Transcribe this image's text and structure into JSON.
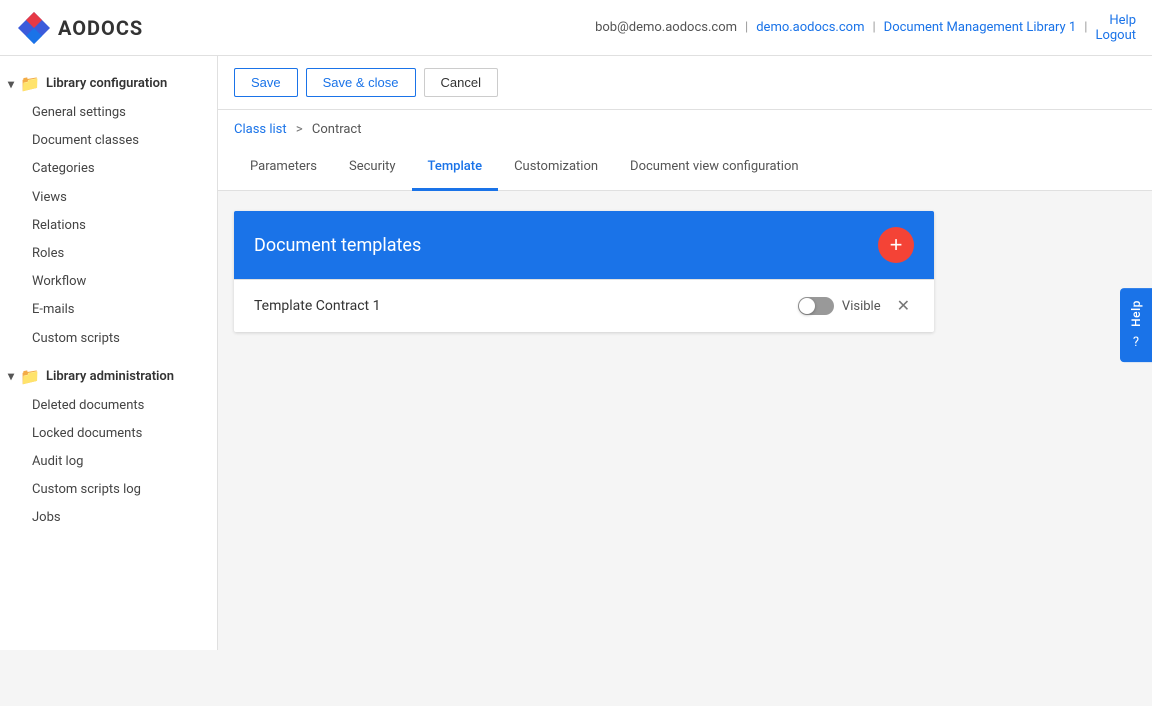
{
  "header": {
    "logo_text": "AODOCS",
    "user_email": "bob@demo.aodocs.com",
    "library_link": "demo.aodocs.com",
    "library_name": "Document Management Library 1",
    "help_label": "Help",
    "logout_label": "Logout"
  },
  "toolbar": {
    "save_label": "Save",
    "save_close_label": "Save & close",
    "cancel_label": "Cancel"
  },
  "breadcrumb": {
    "class_list_label": "Class list",
    "separator": ">",
    "current": "Contract"
  },
  "tabs": [
    {
      "id": "parameters",
      "label": "Parameters"
    },
    {
      "id": "security",
      "label": "Security"
    },
    {
      "id": "template",
      "label": "Template"
    },
    {
      "id": "customization",
      "label": "Customization"
    },
    {
      "id": "document-view-configuration",
      "label": "Document view configuration"
    }
  ],
  "active_tab": "template",
  "templates_section": {
    "title": "Document templates",
    "add_button_icon": "+",
    "templates": [
      {
        "name": "Template Contract 1",
        "visible": false,
        "visible_label": "Visible"
      }
    ]
  },
  "sidebar": {
    "library_config_label": "Library configuration",
    "library_admin_label": "Library administration",
    "config_items": [
      "General settings",
      "Document classes",
      "Categories",
      "Views",
      "Relations",
      "Roles",
      "Workflow",
      "E-mails",
      "Custom scripts"
    ],
    "admin_items": [
      "Deleted documents",
      "Locked documents",
      "Audit log",
      "Custom scripts log",
      "Jobs"
    ]
  },
  "help_sidebar": {
    "label": "Help"
  }
}
